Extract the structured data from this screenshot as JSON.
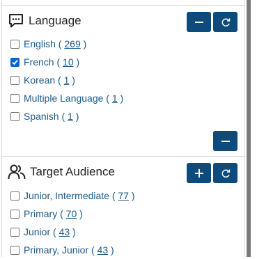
{
  "language": {
    "title": "Language",
    "items": [
      {
        "label": "English",
        "count": "269",
        "checked": false
      },
      {
        "label": "French",
        "count": "10",
        "checked": true
      },
      {
        "label": "Korean",
        "count": "1",
        "checked": false
      },
      {
        "label": "Multiple Language",
        "count": "1",
        "checked": false
      },
      {
        "label": "Spanish",
        "count": "1",
        "checked": false
      }
    ]
  },
  "audience": {
    "title": "Target Audience",
    "items": [
      {
        "label": "Junior, Intermediate",
        "count": "77",
        "checked": false
      },
      {
        "label": "Primary",
        "count": "70",
        "checked": false
      },
      {
        "label": "Junior",
        "count": "43",
        "checked": false
      },
      {
        "label": "Primary, Junior",
        "count": "43",
        "checked": false
      }
    ]
  },
  "colors": {
    "button_bg": "#0d4b7c",
    "link": "#1a5a8c",
    "checkbox_checked": "#0a63d6"
  },
  "icons": {
    "language": "speech-bubble-icon",
    "audience": "people-icon",
    "collapse": "minus-icon",
    "reset": "refresh-icon",
    "expand": "plus-icon"
  }
}
